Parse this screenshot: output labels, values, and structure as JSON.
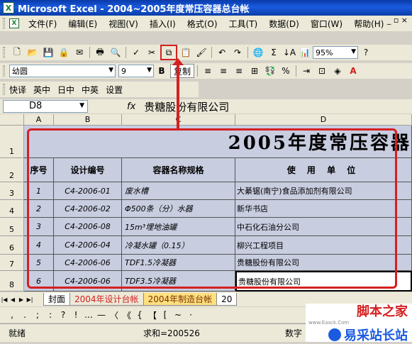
{
  "window": {
    "title": "Microsoft Excel - 2004~2005年度常压容器总台帐",
    "app_icon": "excel-icon"
  },
  "menu": {
    "items": [
      "文件(F)",
      "编辑(E)",
      "视图(V)",
      "插入(I)",
      "格式(O)",
      "工具(T)",
      "数据(D)",
      "窗口(W)",
      "帮助(H)"
    ],
    "window_controls": "_ ▫ ×"
  },
  "standard_toolbar": {
    "zoom": "95%"
  },
  "format_toolbar": {
    "font": "幼圆",
    "size": "9",
    "bold": "B",
    "copy_label": "复制"
  },
  "translate_toolbar": {
    "items": [
      "快译",
      "英中",
      "日中",
      "中英",
      "设置"
    ]
  },
  "formula_bar": {
    "cell_ref": "D8",
    "fx": "fx",
    "content": "贵糖股份有限公司"
  },
  "columns": [
    "A",
    "B",
    "C",
    "D"
  ],
  "rows": [
    "1",
    "2",
    "3",
    "4",
    "5",
    "6",
    "7",
    "8"
  ],
  "sheet": {
    "title": "2005年度常压容器",
    "headers": [
      "序号",
      "设计编号",
      "容器名称规格",
      "使 用 单 位"
    ],
    "data": [
      [
        "1",
        "C4-2006-01",
        "废水槽",
        "大綦锯(南宁)食品添加剂有限公司"
      ],
      [
        "2",
        "C4-2006-02",
        "Φ500条（分）水器",
        "新华书店"
      ],
      [
        "3",
        "C4-2006-08",
        "15m³埋地油罐",
        "中石化石油分公司"
      ],
      [
        "4",
        "C4-2006-04",
        "冷凝水罐（0.15）",
        "柳兴工程项目"
      ],
      [
        "5",
        "C4-2006-06",
        "TDF1.5冷凝器",
        "贵糖股份有限公司"
      ],
      [
        "6",
        "C4-2006-06",
        "TDF3.5冷凝器",
        "贵糖股份有限公司"
      ]
    ]
  },
  "sheet_tabs": [
    "封面",
    "2004年设计台帐",
    "2004年制造台帐",
    "20"
  ],
  "symbols": [
    ",",
    ".",
    ";",
    ":",
    "?",
    "!",
    "…",
    "—",
    "〈",
    "《",
    "{",
    "【",
    "[",
    "~",
    "·"
  ],
  "status": {
    "ready": "就绪",
    "sum": "求和=200526",
    "mode": "数字"
  },
  "watermark": {
    "line1": "脚本之家",
    "line2": "易采站长站",
    "url": "www.Easck.Com"
  },
  "colors": {
    "titlebar": "#0a3aa8",
    "highlight": "#d42020",
    "cell_fill": "#c8cde0"
  }
}
